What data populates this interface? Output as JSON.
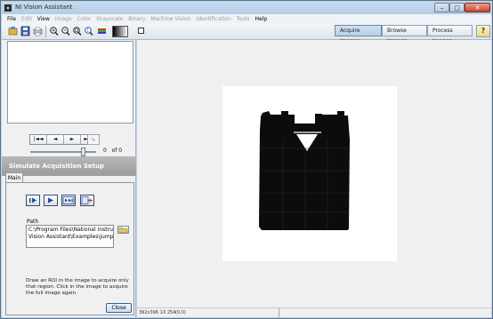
{
  "window": {
    "title": "NI Vision Assistant",
    "controls": [
      "–",
      "□",
      "✕"
    ]
  },
  "menu": [
    {
      "label": "File",
      "enabled": true
    },
    {
      "label": "Edit",
      "enabled": false
    },
    {
      "label": "View",
      "enabled": true
    },
    {
      "label": "Image",
      "enabled": false
    },
    {
      "label": "Color",
      "enabled": false
    },
    {
      "label": "Grayscale",
      "enabled": false
    },
    {
      "label": "Binary",
      "enabled": false
    },
    {
      "label": "Machine Vision",
      "enabled": false
    },
    {
      "label": "Identification",
      "enabled": false
    },
    {
      "label": "Tools",
      "enabled": false
    },
    {
      "label": "Help",
      "enabled": true
    }
  ],
  "toolbar": {
    "icons": [
      "acquire-icon",
      "save-icon",
      "print-icon",
      "zoom-in-icon",
      "zoom-out-icon",
      "zoom-fit-icon",
      "zoom-reset-icon",
      "palette-icon"
    ],
    "mode_tabs": {
      "acquire": "Acquire Images",
      "browse": "Browse Images",
      "process": "Process Images"
    },
    "help": "?"
  },
  "browser": {
    "nav": {
      "first": "|◄◄",
      "prev": "◄",
      "next": "►",
      "last": "►►|",
      "extra": "↳"
    },
    "counter": {
      "current": "0",
      "of": "of",
      "total": "0"
    },
    "slider_level": 0.8
  },
  "panel": {
    "title": "Simulate Acquisition Setup",
    "tab": "Main",
    "path_label": "Path",
    "path_value": "C:\\Program Files\\National Instruments\\\nVision Assistant\\Examples\\jumper",
    "info": "Draw an ROI in the image to acquire only that region. Click in the image to acquire the full image again.",
    "close_label": "Close"
  },
  "status": {
    "size": "392x396 1X 254",
    "coord": "(0,0)"
  }
}
